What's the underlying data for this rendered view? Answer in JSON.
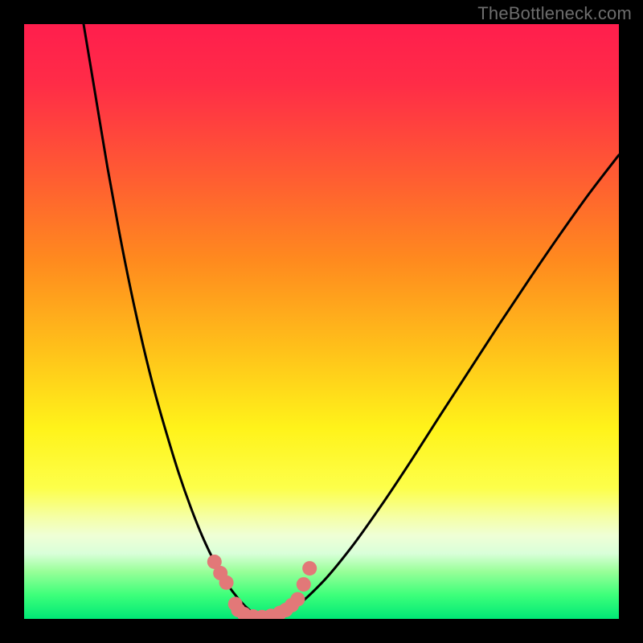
{
  "watermark": "TheBottleneck.com",
  "colors": {
    "black": "#000000",
    "curve": "#000000",
    "marker": "#e27878",
    "gradient_stops": [
      {
        "offset": 0.0,
        "color": "#ff1e4d"
      },
      {
        "offset": 0.1,
        "color": "#ff2c47"
      },
      {
        "offset": 0.25,
        "color": "#ff5a33"
      },
      {
        "offset": 0.4,
        "color": "#ff8b1e"
      },
      {
        "offset": 0.55,
        "color": "#ffc21a"
      },
      {
        "offset": 0.68,
        "color": "#fff31a"
      },
      {
        "offset": 0.78,
        "color": "#fdff4a"
      },
      {
        "offset": 0.83,
        "color": "#f5ffa8"
      },
      {
        "offset": 0.86,
        "color": "#efffd6"
      },
      {
        "offset": 0.89,
        "color": "#d9ffd9"
      },
      {
        "offset": 0.92,
        "color": "#99ff99"
      },
      {
        "offset": 0.96,
        "color": "#3dff7a"
      },
      {
        "offset": 1.0,
        "color": "#00e876"
      }
    ]
  },
  "chart_data": {
    "type": "line",
    "title": "",
    "xlabel": "",
    "ylabel": "",
    "xlim": [
      0,
      100
    ],
    "ylim": [
      0,
      100
    ],
    "grid": false,
    "curve": {
      "name": "bottleneck-curve",
      "x": [
        10,
        12,
        14,
        16,
        18,
        20,
        22,
        24,
        26,
        28,
        30,
        32,
        34,
        36,
        38,
        40,
        45,
        50,
        55,
        60,
        65,
        70,
        75,
        80,
        85,
        90,
        95,
        100
      ],
      "y": [
        100,
        88,
        76,
        65,
        55,
        46,
        38,
        31,
        24.5,
        18.8,
        13.8,
        9.6,
        6.1,
        3.4,
        1.4,
        0.3,
        1.7,
        6.0,
        12.0,
        19.0,
        26.5,
        34.3,
        42.0,
        49.7,
        57.2,
        64.5,
        71.5,
        78.0
      ]
    },
    "markers": {
      "name": "highlight-points",
      "points": [
        {
          "x": 32.0,
          "y": 9.6
        },
        {
          "x": 33.0,
          "y": 7.7
        },
        {
          "x": 34.0,
          "y": 6.1
        },
        {
          "x": 35.5,
          "y": 2.5
        },
        {
          "x": 36.0,
          "y": 1.5
        },
        {
          "x": 37.0,
          "y": 0.8
        },
        {
          "x": 38.5,
          "y": 0.4
        },
        {
          "x": 40.0,
          "y": 0.3
        },
        {
          "x": 41.5,
          "y": 0.5
        },
        {
          "x": 43.0,
          "y": 1.0
        },
        {
          "x": 44.0,
          "y": 1.5
        },
        {
          "x": 45.0,
          "y": 2.3
        },
        {
          "x": 46.0,
          "y": 3.3
        },
        {
          "x": 47.0,
          "y": 5.8
        },
        {
          "x": 48.0,
          "y": 8.5
        }
      ],
      "radius": 9
    }
  }
}
